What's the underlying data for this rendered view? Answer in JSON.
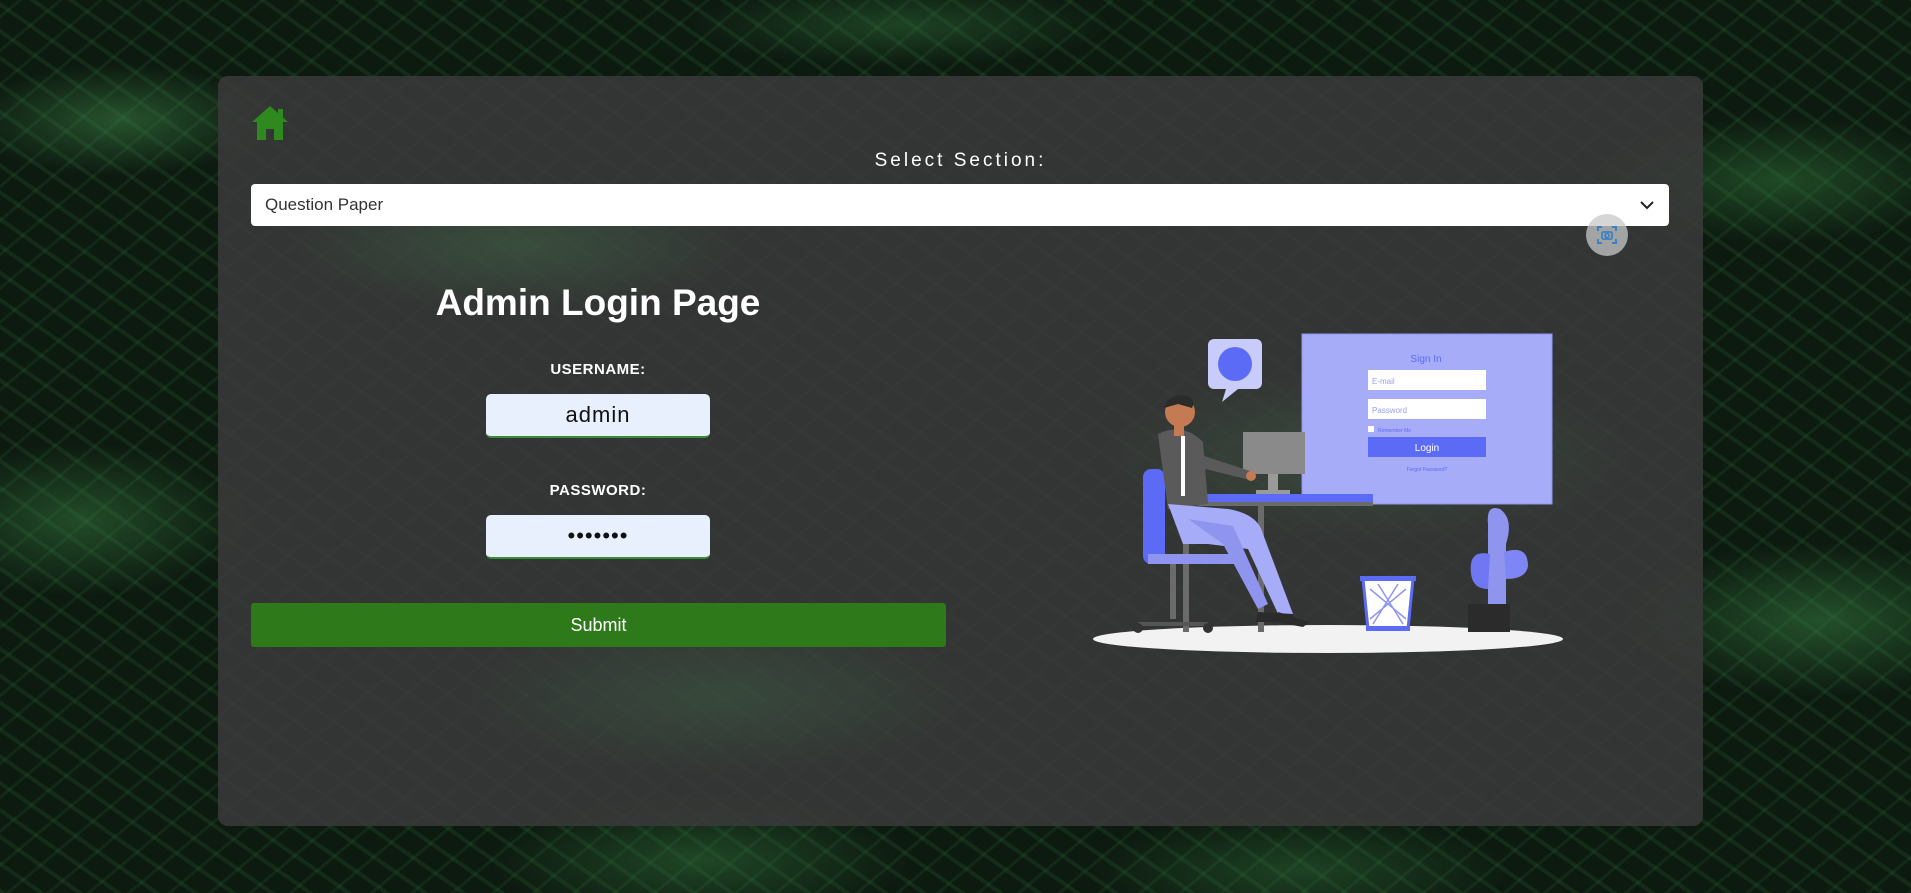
{
  "header": {
    "home_icon": "home-icon",
    "section_label": "Select Section:",
    "section_select": {
      "value": "Question Paper"
    },
    "camera_icon": "camera-scan-icon"
  },
  "login": {
    "title": "Admin Login Page",
    "username_label": "USERNAME:",
    "username_value": "admin",
    "password_label": "PASSWORD:",
    "password_value": "•••••••",
    "submit_label": "Submit"
  },
  "illustration": {
    "screen_title": "Sign In",
    "email_placeholder": "E-mail",
    "password_placeholder": "Password",
    "remember_label": "Remember Me",
    "login_button": "Login",
    "forgot_link": "Forgot Password?"
  },
  "colors": {
    "accent_green": "#2e7a1a",
    "home_icon_green": "#2e8a1e",
    "illustration_blue": "#5b6bf5",
    "illustration_light": "#a7acf8"
  }
}
